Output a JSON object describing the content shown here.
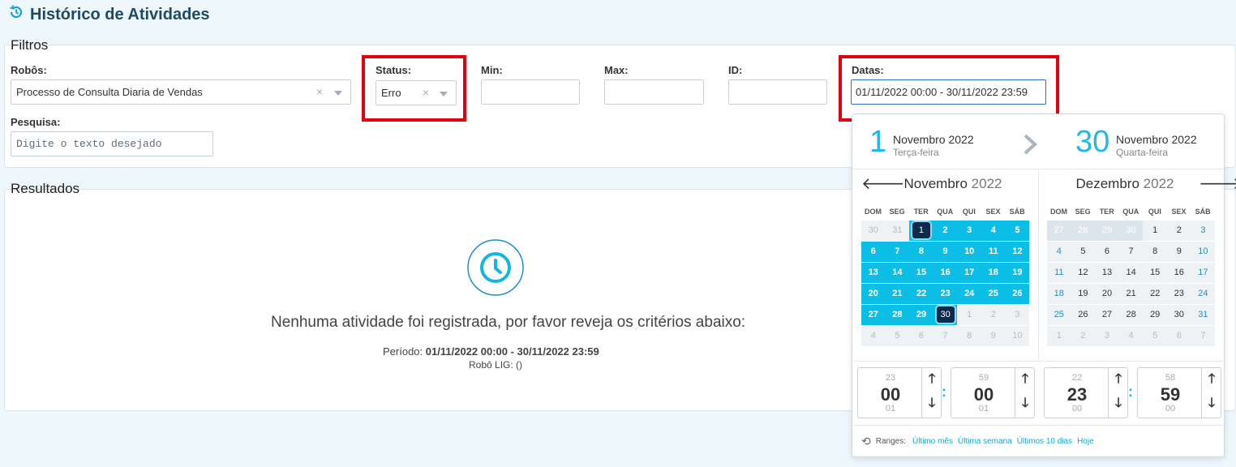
{
  "page": {
    "title": "Histórico de Atividades"
  },
  "filters": {
    "title": "Filtros",
    "robos": {
      "label": "Robôs:",
      "value": "Processo de Consulta Diaria de Vendas"
    },
    "status": {
      "label": "Status:",
      "value": "Erro"
    },
    "min": {
      "label": "Min:",
      "value": ""
    },
    "max": {
      "label": "Max:",
      "value": ""
    },
    "id": {
      "label": "ID:",
      "value": ""
    },
    "datas": {
      "label": "Datas:",
      "value": "01/11/2022 00:00 - 30/11/2022 23:59"
    },
    "pesquisa": {
      "label": "Pesquisa:",
      "placeholder": "Digite o texto desejado"
    }
  },
  "results": {
    "title": "Resultados",
    "empty_message": "Nenhuma atividade foi registrada, por favor reveja os critérios abaixo:",
    "periodo_label": "Período:",
    "periodo_value": "01/11/2022 00:00 - 30/11/2022 23:59",
    "robo_line": "Robô LIG: ()"
  },
  "datepicker": {
    "start": {
      "day": "1",
      "month": "Novembro 2022",
      "weekday": "Terça-feira"
    },
    "end": {
      "day": "30",
      "month": "Novembro 2022",
      "weekday": "Quarta-feira"
    },
    "left_month": {
      "name": "Novembro",
      "year": "2022"
    },
    "right_month": {
      "name": "Dezembro",
      "year": "2022"
    },
    "weekdays": [
      "DOM",
      "SEG",
      "TER",
      "QUA",
      "QUI",
      "SEX",
      "SÁB"
    ],
    "left_days": [
      [
        "30",
        "31",
        "1",
        "2",
        "3",
        "4",
        "5"
      ],
      [
        "6",
        "7",
        "8",
        "9",
        "10",
        "11",
        "12"
      ],
      [
        "13",
        "14",
        "15",
        "16",
        "17",
        "18",
        "19"
      ],
      [
        "20",
        "21",
        "22",
        "23",
        "24",
        "25",
        "26"
      ],
      [
        "27",
        "28",
        "29",
        "30",
        "1",
        "2",
        "3"
      ],
      [
        "4",
        "5",
        "6",
        "7",
        "8",
        "9",
        "10"
      ]
    ],
    "right_days": [
      [
        "27",
        "28",
        "29",
        "30",
        "1",
        "2",
        "3"
      ],
      [
        "4",
        "5",
        "6",
        "7",
        "8",
        "9",
        "10"
      ],
      [
        "11",
        "12",
        "13",
        "14",
        "15",
        "16",
        "17"
      ],
      [
        "18",
        "19",
        "20",
        "21",
        "22",
        "23",
        "24"
      ],
      [
        "25",
        "26",
        "27",
        "28",
        "29",
        "30",
        "31"
      ],
      [
        "1",
        "2",
        "3",
        "4",
        "5",
        "6",
        "7"
      ]
    ],
    "time": {
      "start_hour": {
        "prev": "23",
        "value": "00",
        "next": "01"
      },
      "start_min": {
        "prev": "59",
        "value": "00",
        "next": "01"
      },
      "end_hour": {
        "prev": "22",
        "value": "23",
        "next": "00"
      },
      "end_min": {
        "prev": "58",
        "value": "59",
        "next": "00"
      }
    },
    "ranges": {
      "label": "Ranges:",
      "items": [
        "Último mês",
        "Última semana",
        "Últimos 10 dias",
        "Hoje"
      ]
    },
    "colors": {
      "accent": "#0cbde6",
      "selected": "#0b2a4e"
    }
  }
}
